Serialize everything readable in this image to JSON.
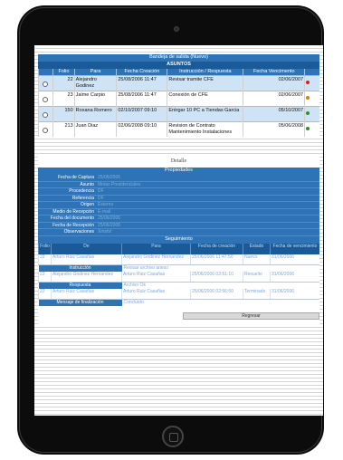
{
  "inbox": {
    "title": "Bandeja de salida (Nuevo)",
    "subtitle": "ASUNTOS",
    "columns": [
      "",
      "Folio",
      "Para",
      "Fecha Creación",
      "Instrucción / Respuesta",
      "Fecha Vencimento",
      ""
    ],
    "rows": [
      {
        "folio": "22",
        "para": "Alejandro Godinez",
        "fecha": "25/08/2006 11:47",
        "instruccion": "Revisar tramite CFE",
        "vence": "02/06/2007",
        "status_color": "#e01b1b"
      },
      {
        "folio": "23",
        "para": "Jaime Carpio",
        "fecha": "25/08/2006 11:47",
        "instruccion": "Conexión de CFE",
        "vence": "02/06/2007",
        "status_color": "#e07b00"
      },
      {
        "folio": "150",
        "para": "Roxana Romero",
        "fecha": "02/10/2007 09:10",
        "instruccion": "Entrgar 10 PC a Tiendas Garcia",
        "vence": "05/10/2007",
        "status_color": "#2f8f2f"
      },
      {
        "folio": "213",
        "para": "Juan Diaz",
        "fecha": "02/06/2008 09:10",
        "instruccion": "Revision de Contrato Mantenimiento Instalaciones",
        "vence": "05/06/2008",
        "status_color": "#2f8f2f"
      }
    ]
  },
  "detail_caption": "Detalle",
  "properties": {
    "title": "Propiedades",
    "rows": [
      {
        "label": "Fecha de Captura",
        "value": "25/06/2006"
      },
      {
        "label": "Asunto",
        "value": "Metas Presidenciales"
      },
      {
        "label": "Procedencia",
        "value": "DF"
      },
      {
        "label": "Referencia",
        "value": "DF"
      },
      {
        "label": "Origen",
        "value": "Externo"
      },
      {
        "label": "Medio de Recepción",
        "value": "E-mail"
      },
      {
        "label": "Fecha del documento",
        "value": "25/06/2006"
      },
      {
        "label": "Fecha de Recepción",
        "value": "25/06/2006"
      },
      {
        "label": "Observaciones",
        "value": "Xmsfsl"
      }
    ]
  },
  "seguimiento": {
    "title": "Seguimiento",
    "columns": [
      "Folio",
      "De",
      "Para",
      "Fecha de creación",
      "Estado",
      "Fecha de vencimiento"
    ],
    "rows": [
      {
        "folio": "22",
        "de": "Arturo Ruiz Casañas",
        "para": "Alejandro Godinez Hernandez",
        "fecha": "25/06/2006 11:47:50",
        "estado": "Nuevo",
        "vence": "31/06/2006",
        "sub_label": "Instrucción",
        "sub_value": "Revisar archivo anexo"
      },
      {
        "folio": "22",
        "de": "Alejandro Godinez Hernandez",
        "para": "Arturo Ruiz Casañas",
        "fecha": "25/06/2006 02:51:10",
        "estado": "Resuelto",
        "vence": "31/06/2006",
        "sub_label": "Respuesta",
        "sub_value": "Archivo Ok"
      },
      {
        "folio": "22",
        "de": "Arturo Ruiz Casañas",
        "para": "Arturo Ruiz Casañas",
        "fecha": "25/06/2006 02:56:50",
        "estado": "Terminado",
        "vence": "31/06/2006",
        "sub_label": "Mensaje de finalización",
        "sub_value": "Concluido"
      }
    ]
  },
  "back_button": "Regresar"
}
